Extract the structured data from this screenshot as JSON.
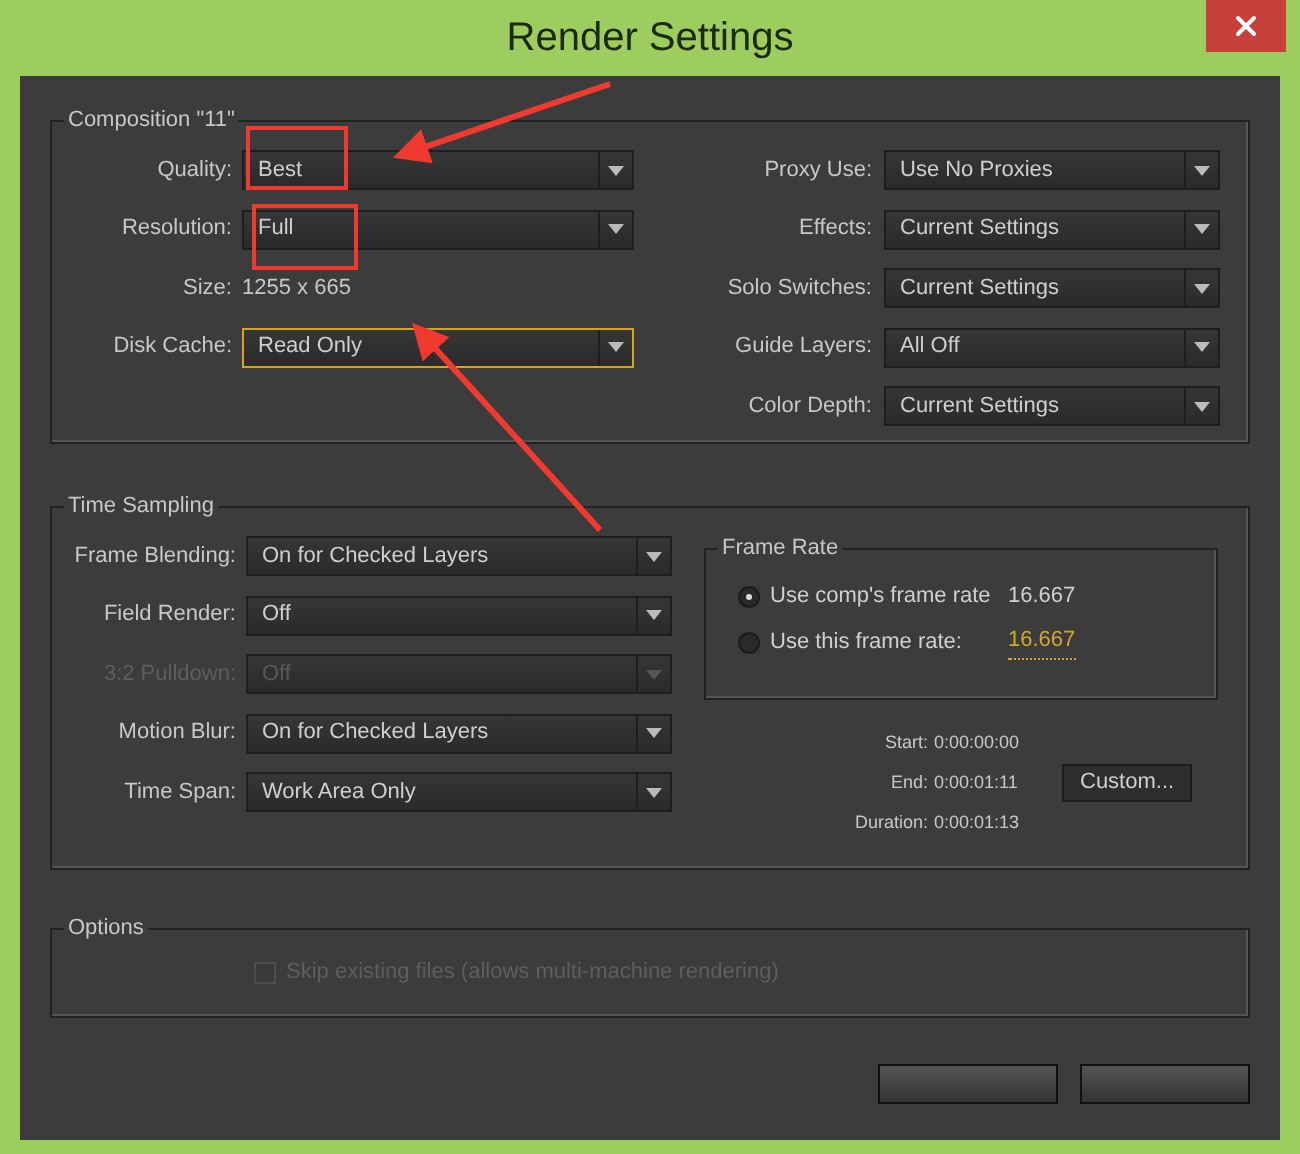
{
  "window": {
    "title": "Render Settings"
  },
  "composition": {
    "title": "Composition \"11\"",
    "left": [
      {
        "kind": "dropdown",
        "label": "Quality:",
        "value": "Best",
        "focused": false
      },
      {
        "kind": "dropdown",
        "label": "Resolution:",
        "value": "Full",
        "focused": false
      },
      {
        "kind": "text",
        "label": "Size:",
        "value": "1255 x 665"
      },
      {
        "kind": "dropdown",
        "label": "Disk Cache:",
        "value": "Read Only",
        "focused": true
      }
    ],
    "right": [
      {
        "label": "Proxy Use:",
        "value": "Use No Proxies"
      },
      {
        "label": "Effects:",
        "value": "Current Settings"
      },
      {
        "label": "Solo Switches:",
        "value": "Current Settings"
      },
      {
        "label": "Guide Layers:",
        "value": "All Off"
      },
      {
        "label": "Color Depth:",
        "value": "Current Settings"
      }
    ]
  },
  "time_sampling": {
    "title": "Time Sampling",
    "fields": [
      {
        "label": "Frame Blending:",
        "value": "On for Checked Layers",
        "disabled": false
      },
      {
        "label": "Field Render:",
        "value": "Off",
        "disabled": false
      },
      {
        "label": "3:2 Pulldown:",
        "value": "Off",
        "disabled": true
      },
      {
        "label": "Motion Blur:",
        "value": "On for Checked Layers",
        "disabled": false
      },
      {
        "label": "Time Span:",
        "value": "Work Area Only",
        "disabled": false
      }
    ],
    "frame_rate": {
      "title": "Frame Rate",
      "options": [
        {
          "label": "Use comp's frame rate",
          "value": "16.667",
          "kind": "static",
          "selected": true
        },
        {
          "label": "Use this frame rate:",
          "value": "16.667",
          "kind": "editable",
          "selected": false
        }
      ]
    },
    "span": [
      {
        "label": "Start:",
        "value": "0:00:00:00"
      },
      {
        "label": "End:",
        "value": "0:00:01:11"
      },
      {
        "label": "Duration:",
        "value": "0:00:01:13"
      }
    ],
    "custom_button": "Custom..."
  },
  "options": {
    "title": "Options",
    "checkbox": {
      "label": "Skip existing files (allows multi-machine rendering)",
      "checked": false,
      "disabled": true
    }
  }
}
